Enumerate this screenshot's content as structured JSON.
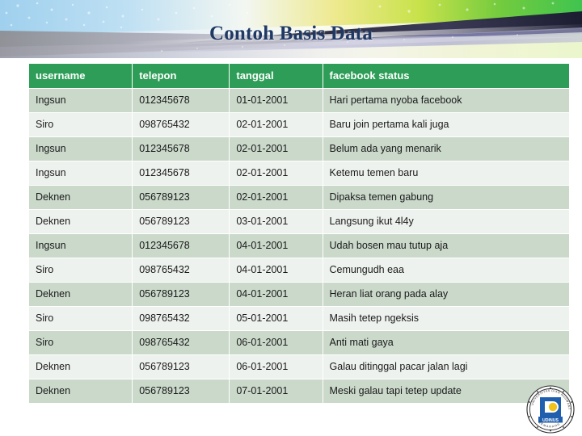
{
  "slide": {
    "title": "Contoh Basis Data"
  },
  "table": {
    "columns": [
      "username",
      "telepon",
      "tanggal",
      "facebook status"
    ],
    "rows": [
      [
        "Ingsun",
        "012345678",
        "01-01-2001",
        "Hari pertama nyoba facebook"
      ],
      [
        "Siro",
        "098765432",
        "02-01-2001",
        "Baru join pertama kali juga"
      ],
      [
        "Ingsun",
        "012345678",
        "02-01-2001",
        "Belum ada yang menarik"
      ],
      [
        "Ingsun",
        "012345678",
        "02-01-2001",
        "Ketemu temen baru"
      ],
      [
        "Deknen",
        "056789123",
        "02-01-2001",
        "Dipaksa temen gabung"
      ],
      [
        "Deknen",
        "056789123",
        "03-01-2001",
        "Langsung ikut 4l4y"
      ],
      [
        "Ingsun",
        "012345678",
        "04-01-2001",
        "Udah bosen mau tutup aja"
      ],
      [
        "Siro",
        "098765432",
        "04-01-2001",
        "Cemungudh eaa"
      ],
      [
        "Deknen",
        "056789123",
        "04-01-2001",
        "Heran liat orang pada alay"
      ],
      [
        "Siro",
        "098765432",
        "05-01-2001",
        "Masih tetep ngeksis"
      ],
      [
        "Siro",
        "098765432",
        "06-01-2001",
        "Anti mati gaya"
      ],
      [
        "Deknen",
        "056789123",
        "06-01-2001",
        "Galau ditinggal pacar jalan lagi"
      ],
      [
        "Deknen",
        "056789123",
        "07-01-2001",
        "Meski galau tapi tetep update"
      ]
    ]
  },
  "logo": {
    "name": "udinus-logo",
    "center_text": "UDINUS",
    "ring_top_text": "UNIVERSITAS DIAN NUSWANTORO",
    "ring_bottom_text": "SEMARANG"
  },
  "colors": {
    "header_green": "#2E9D57",
    "row_odd": "#CBD9CB",
    "row_even": "#EEF2EE",
    "title_navy": "#1F3864",
    "banner_blue": "#A8D4EE",
    "banner_green": "#63C63A",
    "banner_yellow": "#E2E86A",
    "banner_dark": "#23243A",
    "logo_blue": "#1F5FAE",
    "logo_yellow": "#F2C31A"
  }
}
